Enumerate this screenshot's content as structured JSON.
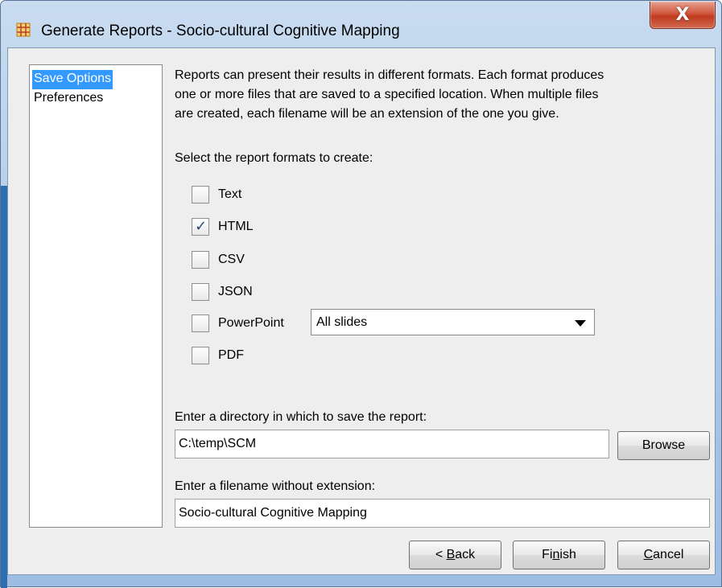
{
  "window": {
    "title": "Generate Reports - Socio-cultural Cognitive Mapping",
    "close_glyph": "X",
    "app_icon": "grid-network-icon",
    "accent_color": "#3399ff"
  },
  "sidebar": {
    "items": [
      {
        "label": "Save Options",
        "selected": true
      },
      {
        "label": "Preferences",
        "selected": false
      }
    ]
  },
  "main": {
    "description_lines": [
      "Reports can present their results in different formats. Each format produces",
      "one or more files that are saved to a specified location. When multiple files",
      "are created, each filename will be an extension of the one you give."
    ],
    "formats_prompt": "Select the report formats to create:",
    "formats": [
      {
        "label": "Text",
        "checked": false
      },
      {
        "label": "HTML",
        "checked": true
      },
      {
        "label": "CSV",
        "checked": false
      },
      {
        "label": "JSON",
        "checked": false
      },
      {
        "label": "PowerPoint",
        "checked": false
      },
      {
        "label": "PDF",
        "checked": false
      }
    ],
    "powerpoint_slides": {
      "selected": "All slides"
    },
    "directory_prompt": "Enter a directory in which to save the report:",
    "directory_value": "C:\\temp\\SCM",
    "browse_label": "Browse",
    "filename_prompt": "Enter a filename without extension:",
    "filename_value": "Socio-cultural Cognitive Mapping"
  },
  "footer": {
    "back": {
      "prefix": "< ",
      "mnemonic": "B",
      "rest": "ack"
    },
    "finish": {
      "prefix": "Fi",
      "mnemonic": "n",
      "rest": "ish"
    },
    "cancel": {
      "prefix": "",
      "mnemonic": "C",
      "rest": "ancel"
    }
  }
}
